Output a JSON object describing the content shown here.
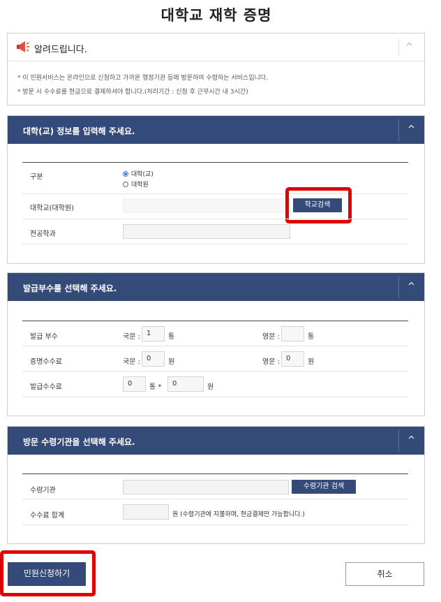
{
  "page_title": "대학교 재학 증명",
  "notice": {
    "title": "알려드립니다.",
    "toggle": "^",
    "lines": [
      "* 이 민원서비스는 온라인으로 신청하고 가까운 행정기관 등에 방문하여 수령하는 서비스입니다.",
      "* 방문 시 수수료를 현금으로 결제하셔야 합니다.(처리기간 : 신청 후 근무시간 내 3시간)"
    ]
  },
  "section_school": {
    "title": "대학(교) 정보를 입력해 주세요.",
    "toggle": "^",
    "type_label": "구분",
    "type_options": [
      "대학(교)",
      "대학원"
    ],
    "type_selected": "대학(교)",
    "school_label": "대학교(대학원)",
    "school_value": "",
    "search_button": "학교검색",
    "major_label": "전공학과",
    "major_value": ""
  },
  "section_copies": {
    "title": "발급부수를 선택해 주세요.",
    "toggle": "^",
    "copies_label": "발급 부수",
    "korean_label": "국문 :",
    "english_label": "영문 :",
    "korean_copies": "1",
    "english_copies": "",
    "copies_unit": "통",
    "fee_label": "증명수수료",
    "korean_fee": "0",
    "english_fee": "0",
    "fee_unit": "원",
    "issue_fee_label": "발급수수료",
    "issue_count": "0",
    "issue_count_unit": "통 *",
    "issue_unit_fee": "0",
    "issue_fee_unit": "원"
  },
  "section_visit": {
    "title": "방문 수령기관을 선택해 주세요.",
    "toggle": "^",
    "agency_label": "수령기관",
    "agency_value": "",
    "agency_button": "수령기관 검색",
    "total_label": "수수료 합계",
    "total_value": "",
    "total_note": "원 (수령기관에 지불하며, 현금결제만 가능합니다.)"
  },
  "actions": {
    "submit": "민원신청하기",
    "cancel": "취소"
  },
  "colors": {
    "navy": "#344a78",
    "highlight": "#e00000",
    "radio_checked": "#2c7be5"
  }
}
